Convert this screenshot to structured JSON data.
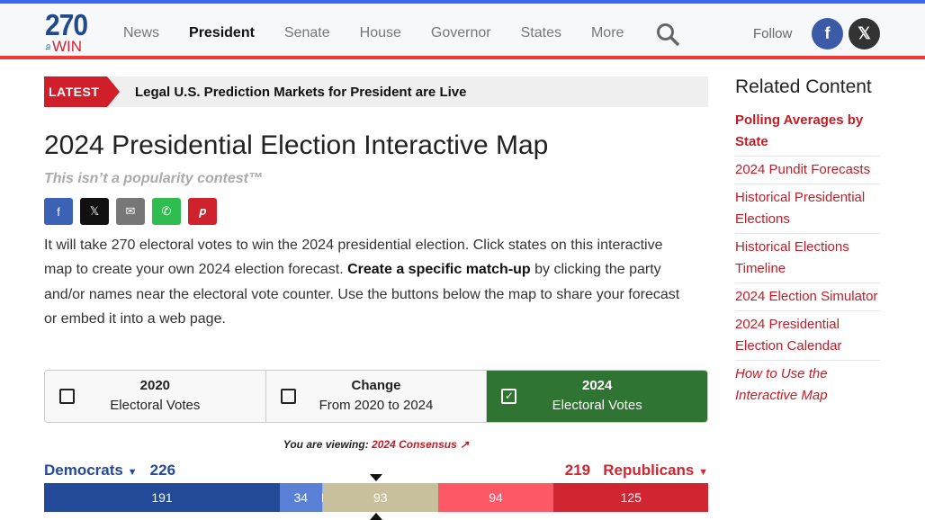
{
  "header": {
    "logo_top": "270",
    "logo_mid": "to",
    "logo_bottom": "WIN",
    "nav": [
      "News",
      "President",
      "Senate",
      "House",
      "Governor",
      "States",
      "More"
    ],
    "active": "President",
    "follow": "Follow"
  },
  "latest": {
    "tag": "LATEST",
    "text": "Legal U.S. Prediction Markets for President are Live"
  },
  "page": {
    "title": "2024 Presidential Election Interactive Map",
    "tagline": "This isn’t a popularity contest™",
    "intro_1": "It will take 270 electoral votes to win the 2024 presidential election. Click states on this interactive map to create your own 2024 election forecast. ",
    "intro_bold": "Create a specific match-up",
    "intro_2": " by clicking the party and/or names near the electoral vote counter. Use the buttons below the map to share your forecast or embed it into a web page."
  },
  "share": [
    "facebook-icon",
    "x-icon",
    "email-icon",
    "whatsapp-icon",
    "pinterest-icon"
  ],
  "tabs": [
    {
      "t1": "2020",
      "t2": "Electoral Votes",
      "checked": false
    },
    {
      "t1": "Change",
      "t2": "From 2020 to 2024",
      "checked": false
    },
    {
      "t1": "2024",
      "t2": "Electoral Votes",
      "checked": true
    }
  ],
  "viewing": {
    "label": "You are viewing:",
    "value": "2024 Consensus"
  },
  "counter": {
    "dem_label": "Democrats",
    "dem_total": "226",
    "rep_label": "Republicans",
    "rep_total": "219",
    "segments": [
      {
        "value": 191,
        "color": "#234a99"
      },
      {
        "value": 34,
        "color": "#5a80d6"
      },
      {
        "value": 1,
        "color": "#92b2f2"
      },
      {
        "value": 93,
        "color": "#c8bf9c"
      },
      {
        "value": 94,
        "color": "#fd5866"
      },
      {
        "value": 125,
        "color": "#d22532"
      }
    ]
  },
  "sidebar": {
    "title": "Related Content",
    "links": [
      "Polling Averages by State",
      "2024 Pundit Forecasts",
      "Historical Presidential Elections",
      "Historical Elections Timeline",
      "2024 Election Simulator",
      "2024 Presidential Election Calendar",
      "How to Use the Interactive Map"
    ]
  }
}
